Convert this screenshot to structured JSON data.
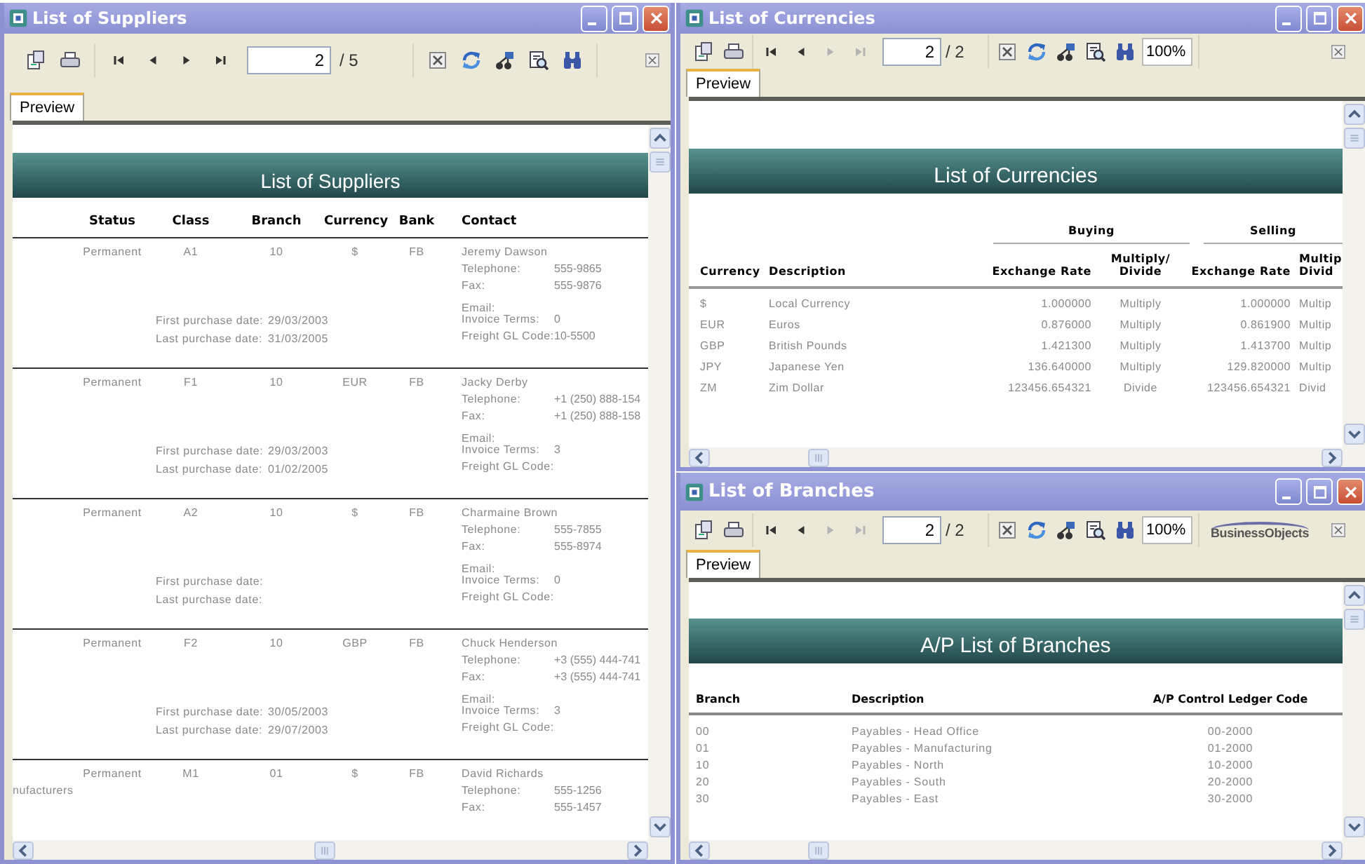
{
  "windows": [
    {
      "kind": "suppliers",
      "title": "List of Suppliers",
      "toolbar": {
        "nav": [
          {
            "kind": "first",
            "disabled": false
          },
          {
            "kind": "previous",
            "disabled": false
          },
          {
            "kind": "next",
            "disabled": false
          },
          {
            "kind": "last",
            "disabled": false
          }
        ],
        "page": "2",
        "page_total": "/ 5"
      },
      "tabs": [
        {
          "label": "Preview",
          "selected": true
        }
      ],
      "report": {
        "title": "List of Suppliers",
        "columns": [
          "Status",
          "Class",
          "Branch",
          "Currency",
          "Bank",
          "Contact"
        ],
        "records": [
          {
            "status": "Permanent",
            "class": "A1",
            "branch": "10",
            "currency": "$",
            "bank": "FB",
            "contact": "Jeremy Dawson",
            "details": [
              {
                "label": "Telephone:",
                "value": "555-9865"
              },
              {
                "label": "Fax:",
                "value": "555-9876"
              },
              {
                "label": "Email:"
              },
              {
                "label": "Invoice Terms:",
                "value": "0"
              },
              {
                "label": "Freight GL Code:",
                "value": "10-5500"
              }
            ],
            "dates": [
              {
                "label": "First purchase date:",
                "value": "29/03/2003"
              },
              {
                "label": "Last purchase date:",
                "value": "31/03/2005"
              }
            ]
          },
          {
            "status": "Permanent",
            "class": "F1",
            "branch": "10",
            "currency": "EUR",
            "bank": "FB",
            "contact": "Jacky Derby",
            "details": [
              {
                "label": "Telephone:",
                "value": "+1 (250) 888-154"
              },
              {
                "label": "Fax:",
                "value": "+1 (250) 888-158"
              },
              {
                "label": "Email:"
              },
              {
                "label": "Invoice Terms:",
                "value": "3"
              },
              {
                "label": "Freight GL Code:"
              }
            ],
            "dates": [
              {
                "label": "First purchase date:",
                "value": "29/03/2003"
              },
              {
                "label": "Last purchase date:",
                "value": "01/02/2005"
              }
            ]
          },
          {
            "status": "Permanent",
            "class": "A2",
            "branch": "10",
            "currency": "$",
            "bank": "FB",
            "contact": "Charmaine Brown",
            "details": [
              {
                "label": "Telephone:",
                "value": "555-7855"
              },
              {
                "label": "Fax:",
                "value": "555-8974"
              },
              {
                "label": "Email:"
              },
              {
                "label": "Invoice Terms:",
                "value": "0"
              },
              {
                "label": "Freight GL Code:"
              }
            ],
            "dates": [
              {
                "label": "First purchase date:"
              },
              {
                "label": "Last purchase date:"
              }
            ]
          },
          {
            "status": "Permanent",
            "class": "F2",
            "branch": "10",
            "currency": "GBP",
            "bank": "FB",
            "contact": "Chuck Henderson",
            "details": [
              {
                "label": "Telephone:",
                "value": "+3 (555) 444-741"
              },
              {
                "label": "Fax:",
                "value": "+3 (555) 444-741"
              },
              {
                "label": "Email:"
              },
              {
                "label": "Invoice Terms:",
                "value": "3"
              },
              {
                "label": "Freight GL Code:"
              }
            ],
            "dates": [
              {
                "label": "First purchase date:",
                "value": "30/05/2003"
              },
              {
                "label": "Last purchase date:",
                "value": "29/07/2003"
              }
            ]
          },
          {
            "fragment": "nufacturers",
            "status": "Permanent",
            "class": "M1",
            "branch": "01",
            "currency": "$",
            "bank": "FB",
            "contact": "David Richards",
            "details": [
              {
                "label": "Telephone:",
                "value": "555-1256"
              },
              {
                "label": "Fax:",
                "value": "555-1457"
              }
            ]
          }
        ]
      }
    },
    {
      "kind": "currencies",
      "title": "List of Currencies",
      "toolbar": {
        "nav": [
          {
            "kind": "first",
            "disabled": false
          },
          {
            "kind": "previous",
            "disabled": false
          },
          {
            "kind": "next",
            "disabled": true
          },
          {
            "kind": "last",
            "disabled": true
          }
        ],
        "page": "2",
        "page_total": "/ 2",
        "zoom": "100%"
      },
      "tabs": [
        {
          "label": "Preview",
          "selected": true
        }
      ],
      "report": {
        "title": "List of Currencies",
        "groups": [
          "Buying",
          "Selling"
        ],
        "columns": [
          "Currency",
          "Description",
          "Exchange Rate",
          "Multiply/ Divide",
          "Exchange Rate",
          "Multip Divid"
        ],
        "rows": [
          [
            "$",
            "Local Currency",
            "1.000000",
            "Multiply",
            "1.000000",
            "Multip"
          ],
          [
            "EUR",
            "Euros",
            "0.876000",
            "Multiply",
            "0.861900",
            "Multip"
          ],
          [
            "GBP",
            "British Pounds",
            "1.421300",
            "Multiply",
            "1.413700",
            "Multip"
          ],
          [
            "JPY",
            "Japanese Yen",
            "136.640000",
            "Multiply",
            "129.820000",
            "Multip"
          ],
          [
            "ZM",
            "Zim Dollar",
            "123456.654321",
            "Divide",
            "123456.654321",
            "Divid"
          ]
        ]
      }
    },
    {
      "kind": "branches",
      "title": "List of Branches",
      "toolbar": {
        "nav": [
          {
            "kind": "first",
            "disabled": false
          },
          {
            "kind": "previous",
            "disabled": false
          },
          {
            "kind": "next",
            "disabled": true
          },
          {
            "kind": "last",
            "disabled": true
          }
        ],
        "page": "2",
        "page_total": "/ 2",
        "zoom": "100%",
        "brand": "BusinessObjects"
      },
      "tabs": [
        {
          "label": "Preview",
          "selected": true
        }
      ],
      "report": {
        "title": "A/P List of Branches",
        "columns": [
          "Branch",
          "Description",
          "A/P Control Ledger Code"
        ],
        "rows": [
          [
            "00",
            "Payables - Head Office",
            "00-2000"
          ],
          [
            "01",
            "Payables - Manufacturing",
            "01-2000"
          ],
          [
            "10",
            "Payables - North",
            "10-2000"
          ],
          [
            "20",
            "Payables - South",
            "20-2000"
          ],
          [
            "30",
            "Payables - East",
            "30-2000"
          ]
        ]
      }
    }
  ]
}
